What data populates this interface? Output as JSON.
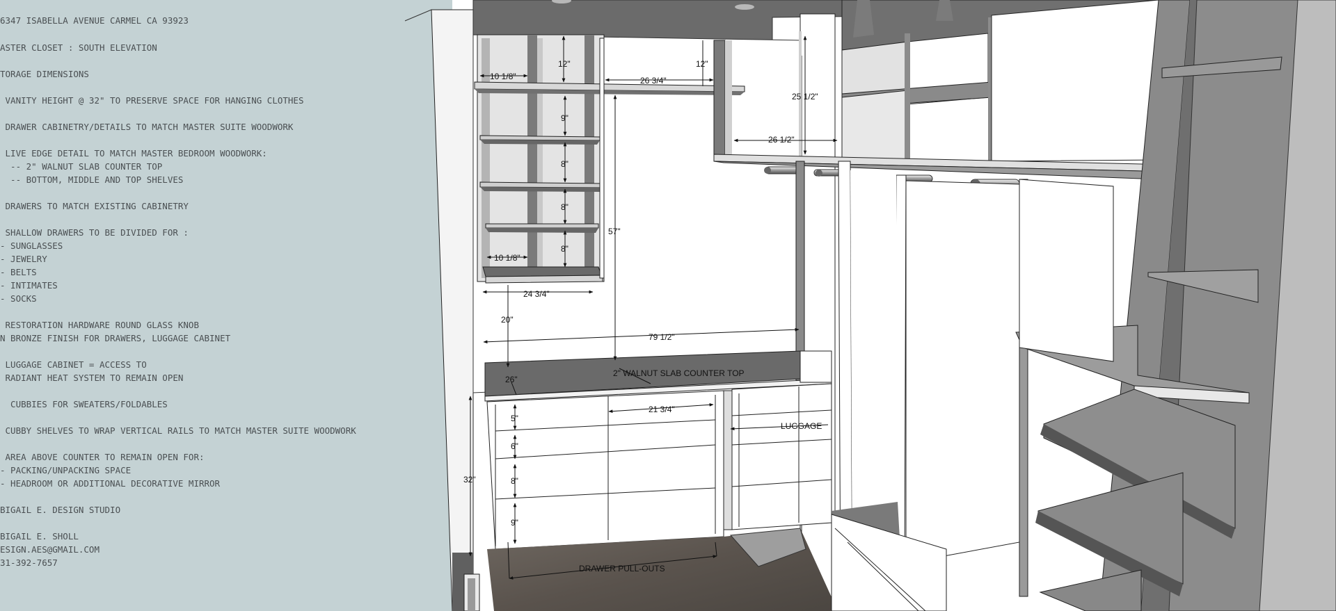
{
  "notes": [
    "6347 ISABELLA AVENUE CARMEL CA 93923",
    "ASTER CLOSET : SOUTH ELEVATION",
    "TORAGE DIMENSIONS",
    " VANITY HEIGHT @ 32\" TO PRESERVE SPACE FOR HANGING CLOTHES",
    " DRAWER CABINETRY/DETAILS TO MATCH MASTER SUITE WOODWORK",
    " LIVE EDGE DETAIL TO MATCH MASTER BEDROOM WOODWORK:",
    "  -- 2\" WALNUT SLAB COUNTER TOP",
    "  -- BOTTOM, MIDDLE AND TOP SHELVES",
    " DRAWERS TO MATCH EXISTING CABINETRY",
    " SHALLOW DRAWERS TO BE DIVIDED FOR :",
    "- SUNGLASSES",
    "- JEWELRY",
    "- BELTS",
    "- INTIMATES",
    "- SOCKS",
    " RESTORATION HARDWARE ROUND GLASS KNOB",
    "N BRONZE FINISH FOR DRAWERS, LUGGAGE CABINET",
    " LUGGAGE CABINET = ACCESS TO",
    " RADIANT HEAT SYSTEM TO REMAIN OPEN",
    "  CUBBIES FOR SWEATERS/FOLDABLES",
    " CUBBY SHELVES TO WRAP VERTICAL RAILS TO MATCH MASTER SUITE WOODWORK",
    " AREA ABOVE COUNTER TO REMAIN OPEN FOR:",
    "- PACKING/UNPACKING SPACE",
    "- HEADROOM OR ADDITIONAL DECORATIVE MIRROR",
    "BIGAIL E. DESIGN STUDIO",
    "BIGAIL E. SHOLL",
    "ESIGN.AES@GMAIL.COM",
    "31-392-7657"
  ],
  "dimensions": {
    "cubby_width_top": "10 1/8\"",
    "top_cubby_height": "12\"",
    "top_shelf_span": "26 3/4\"",
    "right_top_height": "12\"",
    "upper_opening_height": "25 1/2\"",
    "upper_opening_width": "26 1/2\"",
    "cubby_9": "9\"",
    "cubby_8a": "8\"",
    "cubby_8b": "8\"",
    "cubby_8c": "8\"",
    "cubby_width_bottom": "10 1/8\"",
    "vertical_57": "57\"",
    "cubby_unit_width": "24 3/4\"",
    "gap_20": "20\"",
    "counter_length": "79 1/2\"",
    "counter_depth": "26\"",
    "drawer_width": "21 3/4\"",
    "drawer_5": "5\"",
    "drawer_6": "6\"",
    "drawer_8": "8\"",
    "drawer_9": "9\"",
    "vanity_height": "32\""
  },
  "labels": {
    "counter_top": "2\" WALNUT SLAB COUNTER TOP",
    "luggage": "LUGGAGE",
    "drawer_pullouts": "DRAWER PULL-OUTS"
  }
}
